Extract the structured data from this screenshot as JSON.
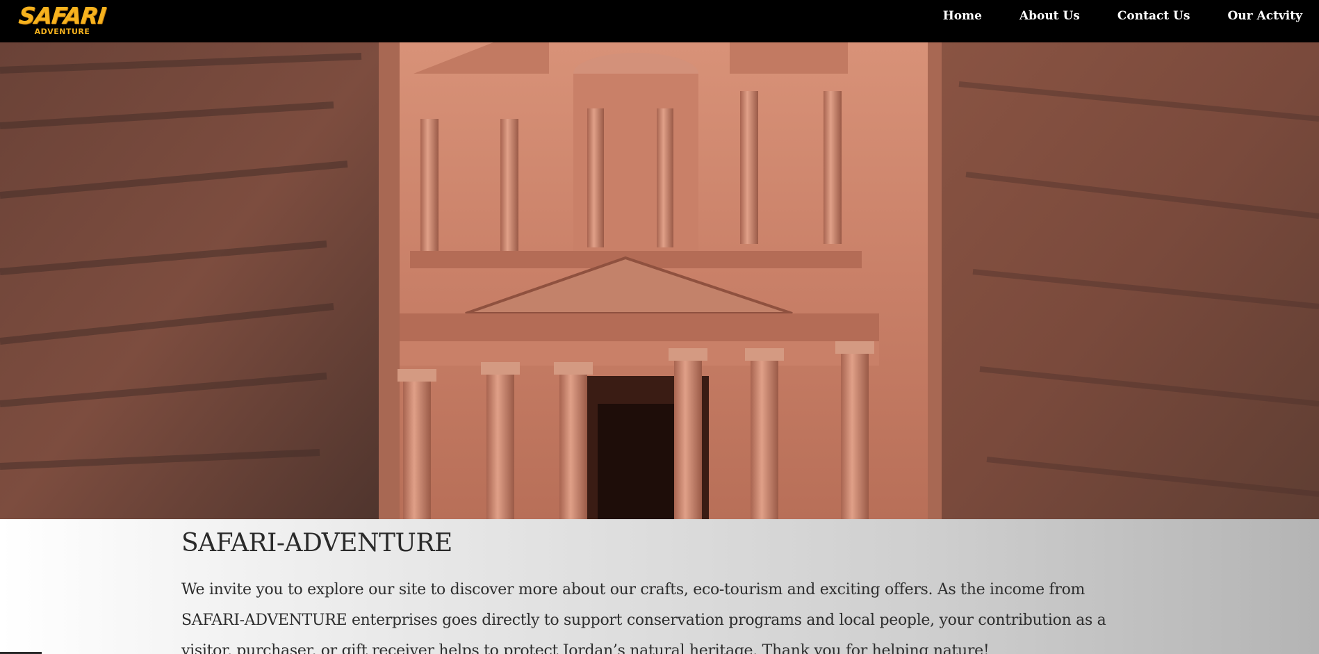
{
  "logo": {
    "main": "SAFARI",
    "sub": "ADVENTURE",
    "color": "#f6b21e"
  },
  "nav": {
    "items": [
      {
        "label": "Home"
      },
      {
        "label": "About Us"
      },
      {
        "label": "Contact Us"
      },
      {
        "label": "Our Actvity"
      }
    ]
  },
  "hero": {
    "image": "petra-treasury-photo"
  },
  "content": {
    "title": "SAFARI-ADVENTURE",
    "intro": "We invite you to explore our site to discover more about our crafts, eco-tourism and exciting offers. As the income from SAFARI-ADVENTURE enterprises goes directly to support conservation programs and local people, your contribution as a visitor, purchaser, or gift receiver helps to protect Jordan’s natural heritage. Thank you for helping nature!"
  }
}
